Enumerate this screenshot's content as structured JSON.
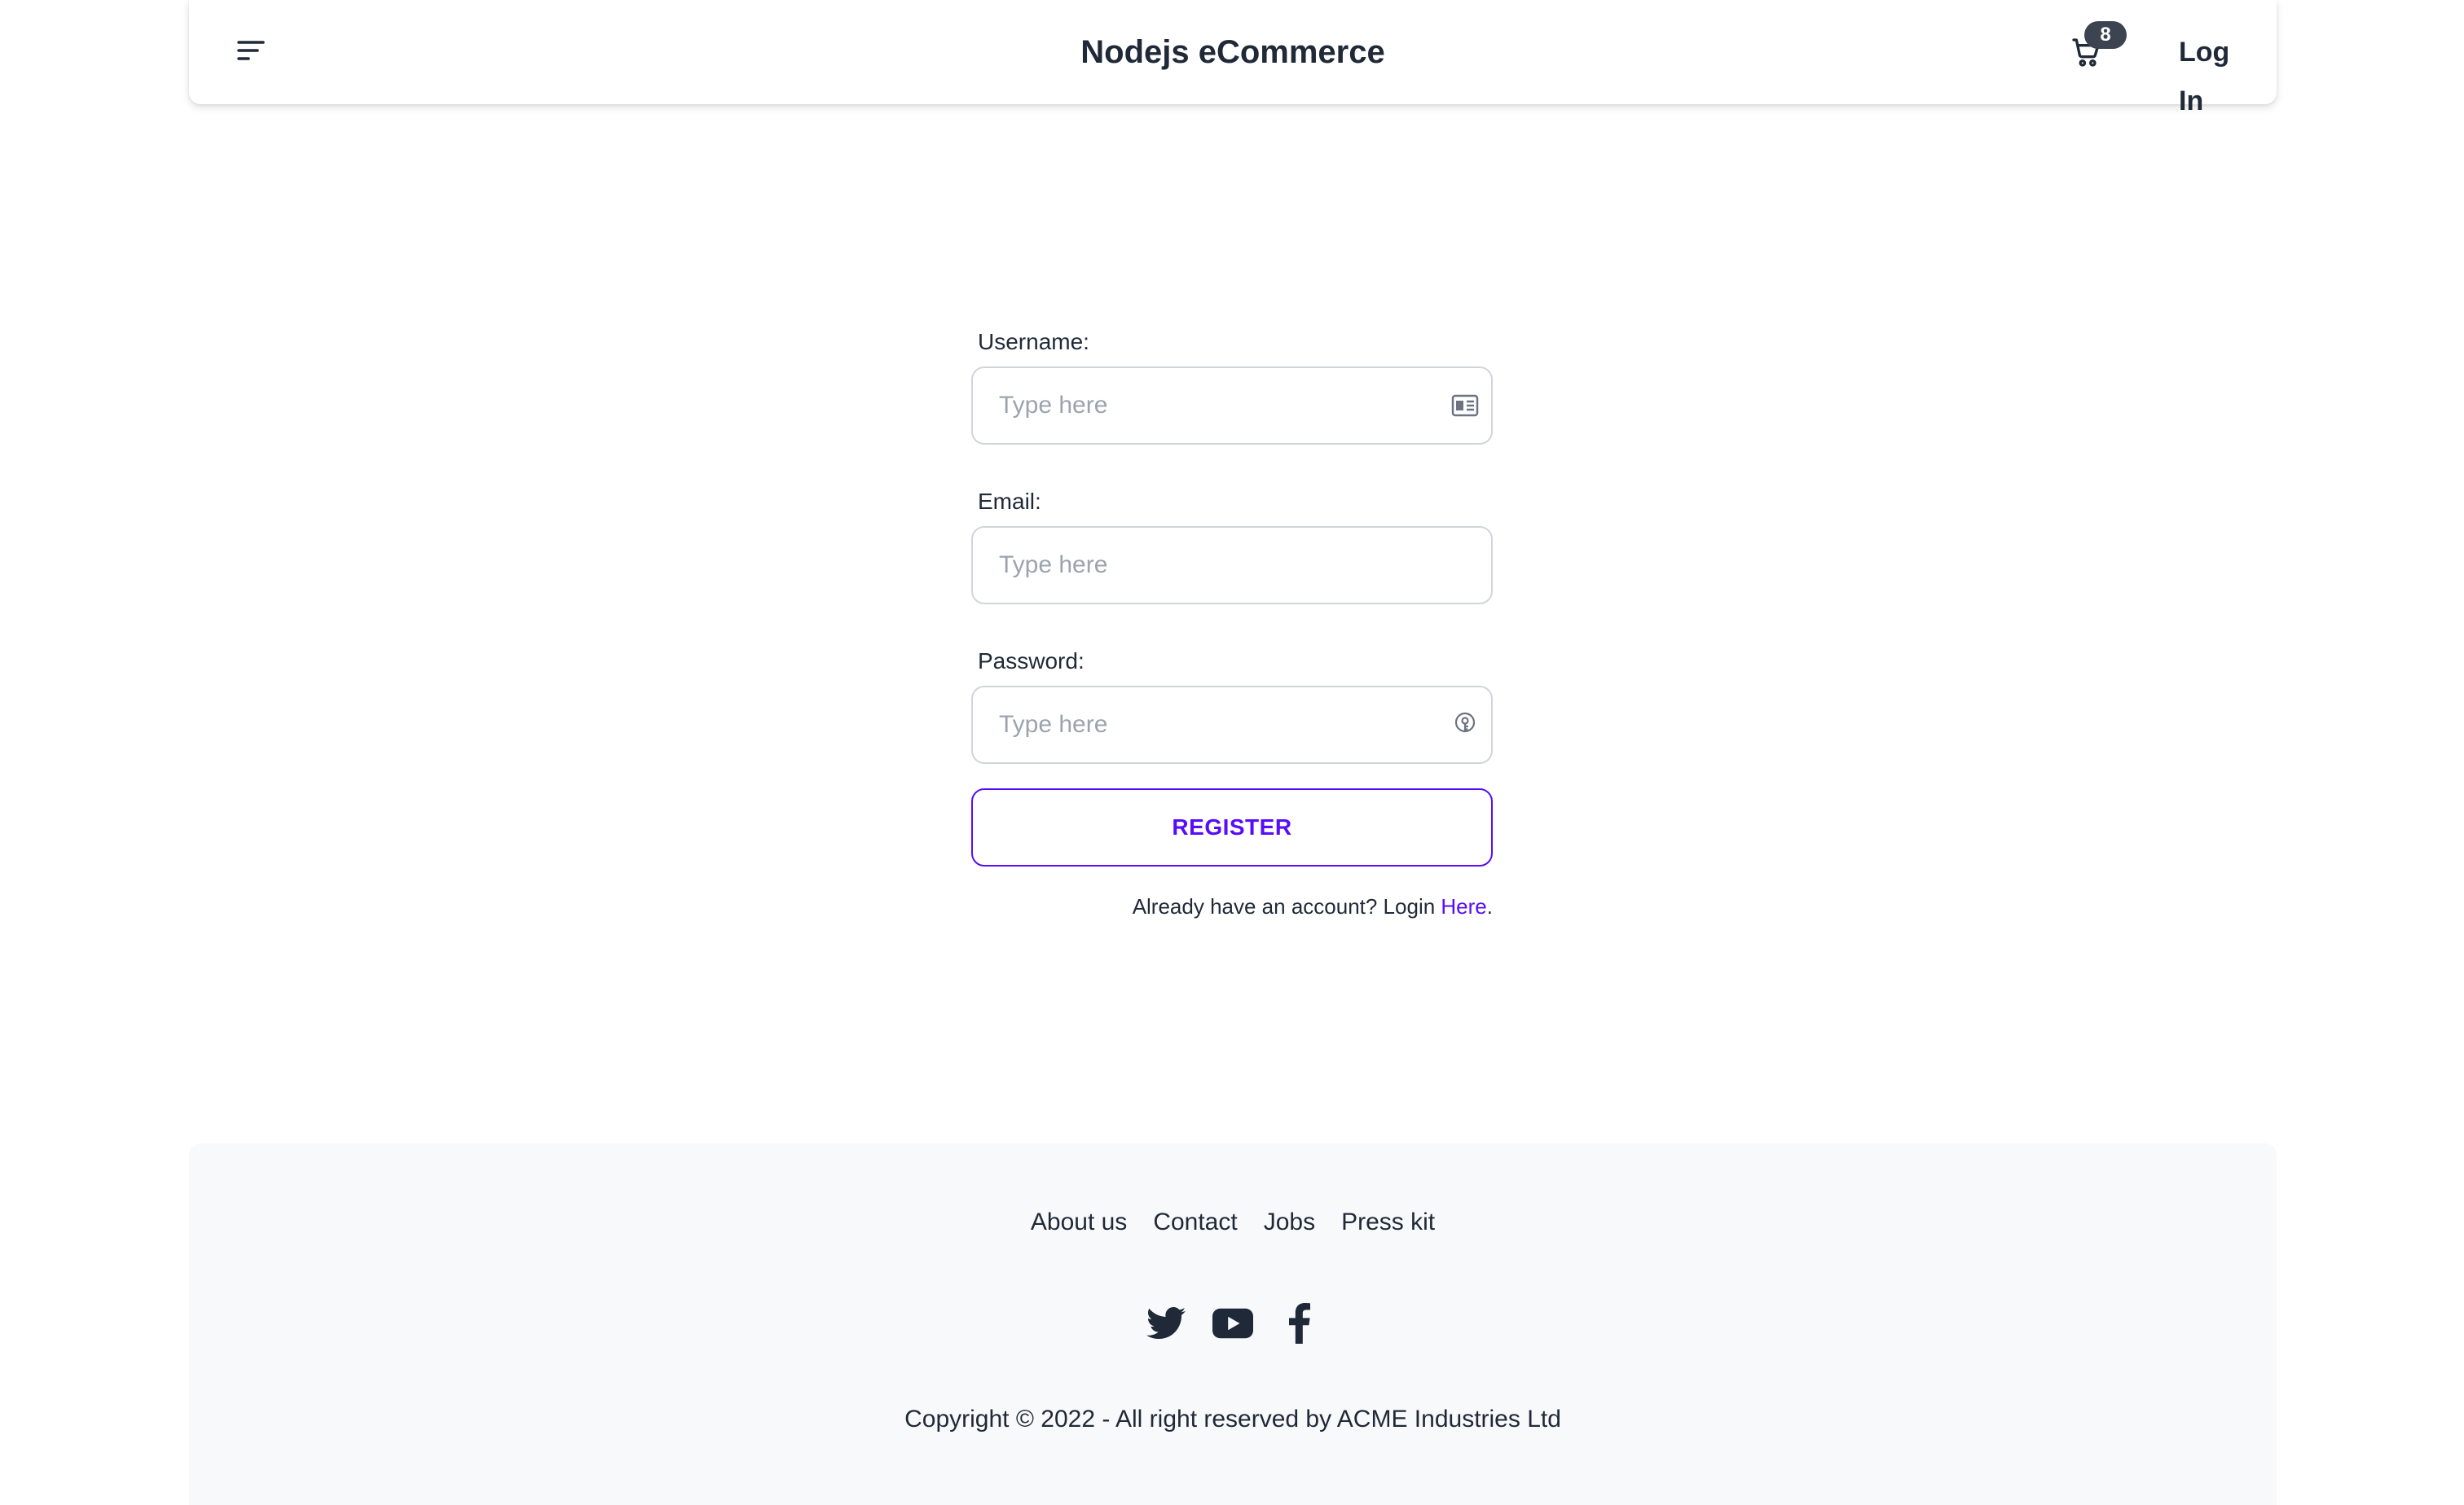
{
  "header": {
    "brand": "Nodejs eCommerce",
    "cart_count": "8",
    "login_label": "Log In",
    "menu_icon": "menu-icon",
    "cart_icon": "cart-icon"
  },
  "form": {
    "username": {
      "label": "Username:",
      "placeholder": "Type here",
      "value": "",
      "icon": "id-card-icon"
    },
    "email": {
      "label": "Email:",
      "placeholder": "Type here",
      "value": ""
    },
    "password": {
      "label": "Password:",
      "placeholder": "Type here",
      "value": "",
      "icon": "key-icon"
    },
    "register_label": "REGISTER",
    "already_text": "Already have an account? Login ",
    "here_link": "Here",
    "period": "."
  },
  "footer": {
    "links": [
      "About us",
      "Contact",
      "Jobs",
      "Press kit"
    ],
    "social": [
      "twitter-icon",
      "youtube-icon",
      "facebook-icon"
    ],
    "copyright": "Copyright © 2022 - All right reserved by ACME Industries Ltd"
  },
  "colors": {
    "accent": "#570df8",
    "badge": "#3d4451",
    "text": "#1f2937",
    "footer_bg": "#f8f9fb"
  }
}
